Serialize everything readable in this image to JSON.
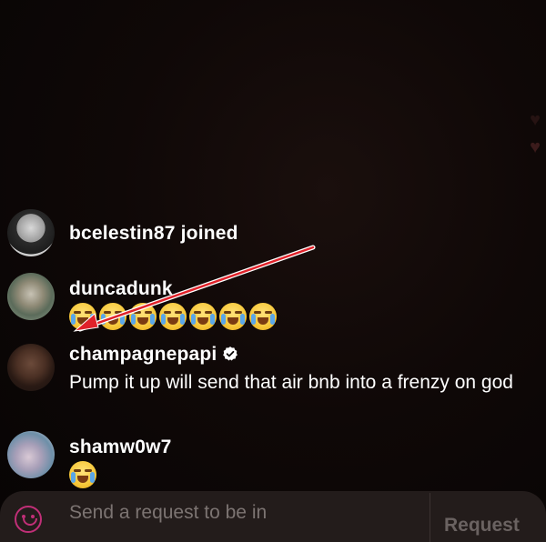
{
  "comments": [
    {
      "username": "bcelestin87 joined",
      "avatar_icon": "avatar-bcelestin87"
    },
    {
      "username": "duncadunk",
      "emoji": [
        "😭",
        "😭",
        "😭",
        "😭",
        "😭",
        "😭",
        "😭"
      ],
      "avatar_icon": "avatar-duncadunk"
    },
    {
      "username": "champagnepapi",
      "verified": true,
      "message": "Pump it up will send that air bnb into a frenzy on god",
      "avatar_icon": "avatar-champagnepapi"
    },
    {
      "username": "shamw0w7",
      "emoji": [
        "😂"
      ],
      "avatar_icon": "avatar-shamw0w7"
    }
  ],
  "request_bar": {
    "placeholder": "Send a request to be in",
    "button_label": "Request"
  },
  "colors": {
    "background": "#0a0505",
    "arrow": "#e0222a",
    "verified_badge": "#ffffff",
    "request_icon": "#c02f77"
  },
  "icons": {
    "hearts": "heart-icon",
    "verified": "verified-badge-icon",
    "request": "face-icon"
  }
}
